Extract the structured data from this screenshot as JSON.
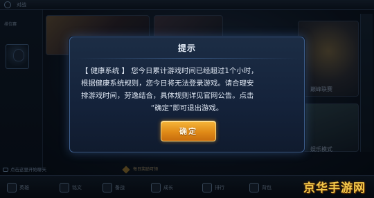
{
  "background": {
    "top_tab": "对战",
    "left_panel_title": "排位赛",
    "card_label_a": "巅峰联赛",
    "card_label_b": "娱乐模式",
    "chat_hint": "点击这里开始聊天",
    "reward_text": "每日奖励可领"
  },
  "bottom_nav": [
    {
      "label": "英雄",
      "icon": "hero-icon"
    },
    {
      "label": "铭文",
      "icon": "inscription-icon"
    },
    {
      "label": "备战",
      "icon": "prepare-icon"
    },
    {
      "label": "成长",
      "icon": "growth-icon"
    },
    {
      "label": "排行",
      "icon": "rank-icon"
    },
    {
      "label": "背包",
      "icon": "bag-icon"
    }
  ],
  "dialog": {
    "title": "提示",
    "body_lines": [
      "【 健康系统 】 您今日累计游戏时间已经超过1个小时，",
      "根据健康系统规则，您今日将无法登录游戏。请合理安",
      "排游戏时间，劳逸结合，具体规则详见官网公告。点击",
      "“确定”即可退出游戏。"
    ],
    "confirm_label": "确定"
  },
  "watermark": "京华手游网",
  "colors": {
    "accent_button": "#e08a17",
    "dialog_border": "#3f6190",
    "watermark": "#f3c84b"
  }
}
